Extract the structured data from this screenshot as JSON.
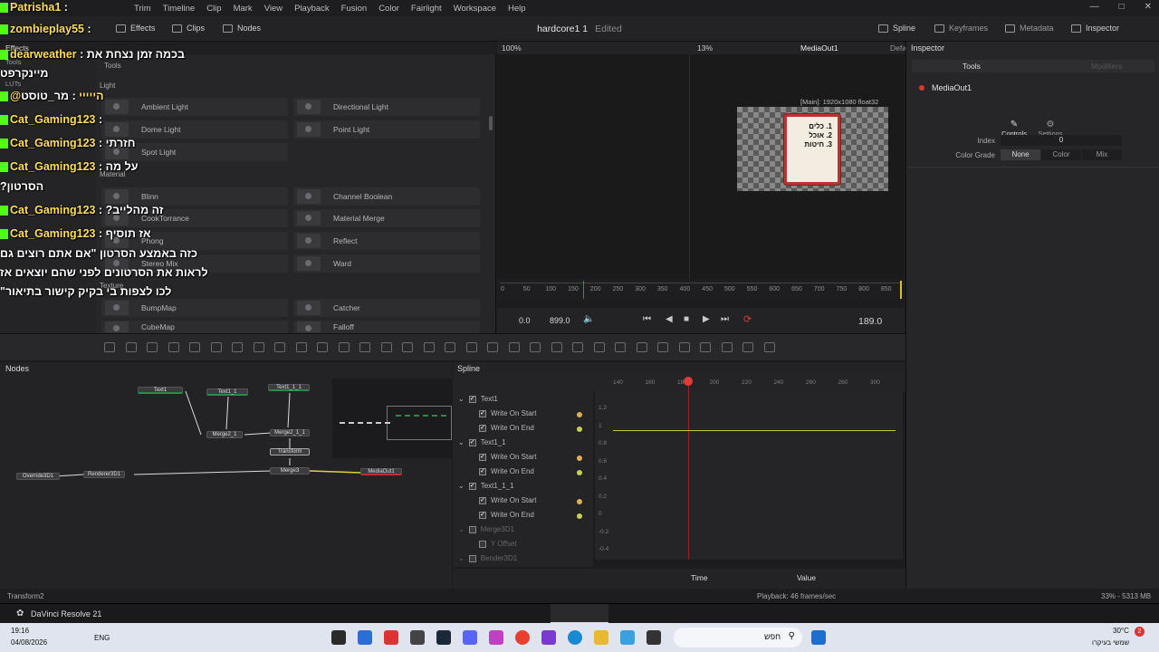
{
  "menu": [
    "Trim",
    "Timeline",
    "Clip",
    "Mark",
    "View",
    "Playback",
    "Fusion",
    "Color",
    "Fairlight",
    "Workspace",
    "Help"
  ],
  "toolbar": {
    "effects": "Effects",
    "clips": "Clips",
    "nodes": "Nodes",
    "spline": "Spline",
    "keyframes": "Keyframes",
    "metadata": "Metadata",
    "inspector": "Inspector"
  },
  "project": {
    "title": "hardcore1 1",
    "status": "Edited"
  },
  "effects_panel": {
    "title": "Effects",
    "tree": [
      "Tools",
      "LUTs"
    ],
    "tree_header": "Tools",
    "categories": [
      "Light",
      "Material",
      "Texture"
    ],
    "left_col": [
      "Ambient Light",
      "Dome Light",
      "Spot Light",
      "Blinn",
      "CookTorrance",
      "Phong",
      "Stereo Mix",
      "BumpMap",
      "CubeMap"
    ],
    "right_col": [
      "Directional Light",
      "Point Light",
      "Channel Boolean",
      "Material Merge",
      "Reflect",
      "Ward",
      "Catcher",
      "Falloff"
    ]
  },
  "viewer": {
    "zoom_left": "100%",
    "zoom_right": "13%",
    "output": "MediaOut1",
    "default": "Defa",
    "resolution": "[Main]: 1920x1080 float32"
  },
  "paper_lines": [
    "1. כלים",
    "2. אוכל",
    "3. חיטות"
  ],
  "ruler": [
    "0",
    "50",
    "100",
    "150",
    "200",
    "250",
    "300",
    "350",
    "400",
    "450",
    "500",
    "550",
    "600",
    "650",
    "700",
    "750",
    "800",
    "850"
  ],
  "transport": {
    "start": "0.0",
    "end": "899.0",
    "current": "189.0"
  },
  "inspector": {
    "title": "Inspector",
    "tabs": [
      "Tools",
      "Modifiers"
    ],
    "node": "MediaOut1",
    "subtabs": [
      "Controls",
      "Settings"
    ],
    "index_label": "Index",
    "index_value": "0",
    "colorgrade_label": "Color Grade",
    "colorgrade_options": [
      "None",
      "Color",
      "Mix"
    ]
  },
  "nodes_panel": {
    "title": "Nodes",
    "nodes": [
      "Text1",
      "Text1_1",
      "Text1_1_1",
      "Merge2_1",
      "Merge2_1_1",
      "Transform",
      "Merge3",
      "MediaOut1",
      "Override3D1",
      "Renderer3D1"
    ]
  },
  "spline_panel": {
    "title": "Spline",
    "items": [
      {
        "label": "Text1",
        "level": 0,
        "checked": true
      },
      {
        "label": "Write On Start",
        "level": 1,
        "checked": true,
        "key": "#e0b050"
      },
      {
        "label": "Write On End",
        "level": 1,
        "checked": true,
        "key": "#c8d050"
      },
      {
        "label": "Text1_1",
        "level": 0,
        "checked": true
      },
      {
        "label": "Write On Start",
        "level": 1,
        "checked": true,
        "key": "#e0b050"
      },
      {
        "label": "Write On End",
        "level": 1,
        "checked": true,
        "key": "#c8d050"
      },
      {
        "label": "Text1_1_1",
        "level": 0,
        "checked": true
      },
      {
        "label": "Write On Start",
        "level": 1,
        "checked": true,
        "key": "#e0b050"
      },
      {
        "label": "Write On End",
        "level": 1,
        "checked": true,
        "key": "#c8d050"
      },
      {
        "label": "Merge3D1",
        "level": 0,
        "checked": false
      },
      {
        "label": "Y Offset",
        "level": 1,
        "checked": false
      },
      {
        "label": "Bender3D1",
        "level": 0,
        "checked": false
      }
    ],
    "xticks": [
      "140",
      "160",
      "180",
      "200",
      "220",
      "240",
      "260",
      "280",
      "300"
    ],
    "yticks": [
      "1.2",
      "1",
      "0.8",
      "0.6",
      "0.4",
      "0.2",
      "0",
      "-0.2",
      "-0.4"
    ],
    "time_label": "Time",
    "value_label": "Value"
  },
  "status": {
    "left": "Transform2",
    "mid": "Playback: 46 frames/sec",
    "right": "33% - 5313 MB"
  },
  "app_name": "DaVinci Resolve 21",
  "taskbar": {
    "time": "19:16",
    "date": "04/08/2026",
    "lang": "ENG",
    "search": "חפש",
    "temp": "30°C",
    "weather": "שמשי בעיקרו",
    "notif": "2"
  },
  "chat": [
    {
      "user": "Patrisha1",
      "sep": " : ",
      "msg": "",
      "top": 1
    },
    {
      "user": "zombieplay55",
      "sep": " : ",
      "msg": "",
      "top": 25
    },
    {
      "user": "dearweather",
      "sep": " : ",
      "msg": "בכמה זמן נצחת את",
      "top": 53
    },
    {
      "user": "",
      "sep": "",
      "msg": "מיינקרפט",
      "top": 74
    },
    {
      "user": "@הייייי",
      "sep": " : ",
      "msg": "מר_טוסט",
      "top": 99
    },
    {
      "user": "Cat_Gaming123",
      "sep": " : ",
      "msg": "",
      "top": 125
    },
    {
      "user": "Cat_Gaming123",
      "sep": " : ",
      "msg": "חזרתי",
      "top": 151
    },
    {
      "user": "Cat_Gaming123",
      "sep": " : ",
      "msg": "על מה",
      "top": 177
    },
    {
      "user": "",
      "sep": "",
      "msg": "?הסרטון",
      "top": 199
    },
    {
      "user": "Cat_Gaming123",
      "sep": " : ",
      "msg": "?זה מהלייב",
      "top": 225
    },
    {
      "user": "Cat_Gaming123",
      "sep": " : ",
      "msg": "אז תוסיף",
      "top": 251
    },
    {
      "user": "",
      "sep": "",
      "msg": "כזה באמצע הסרטון \"אם אתם רוצים גם",
      "top": 273
    },
    {
      "user": "",
      "sep": "",
      "msg": "לראות את הסרטונים לפני שהם יוצאים אז",
      "top": 294
    },
    {
      "user": "",
      "sep": "",
      "msg": "\"לכו לצפות בי בקיק קישור בתיאור",
      "top": 315
    }
  ],
  "colors": {
    "accent": "#e0b050",
    "playhead": "#e03a3a",
    "chat_user": "#ffde59"
  }
}
